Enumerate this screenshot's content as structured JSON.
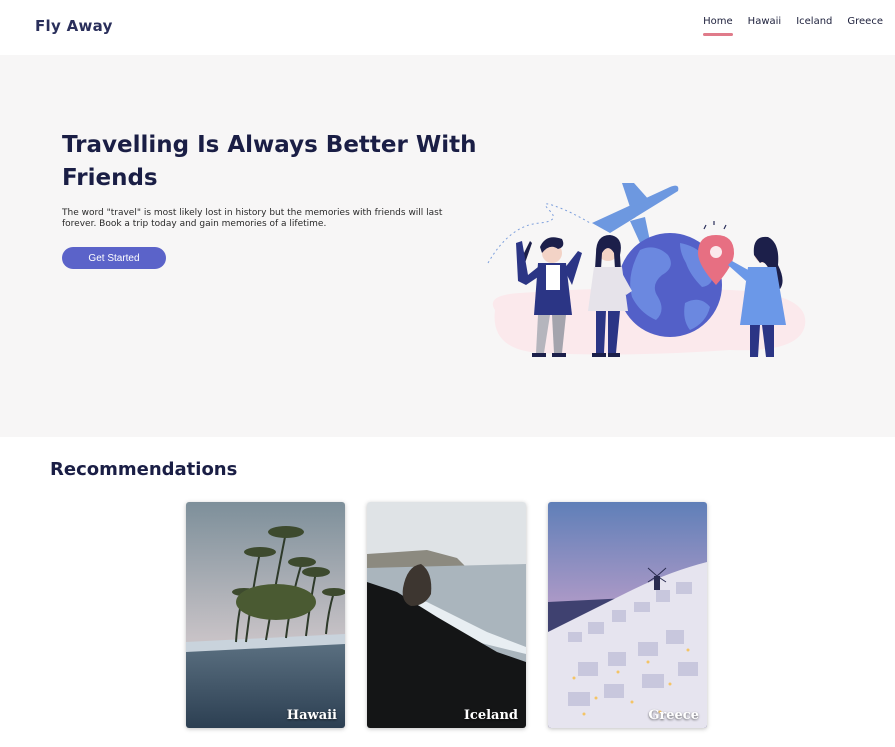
{
  "navbar": {
    "brand": "Fly Away",
    "links": [
      {
        "label": "Home",
        "active": true
      },
      {
        "label": "Hawaii",
        "active": false
      },
      {
        "label": "Iceland",
        "active": false
      },
      {
        "label": "Greece",
        "active": false
      }
    ],
    "active_underline_color": "#e07b8a"
  },
  "hero": {
    "title": "Travelling Is Always Better With Friends",
    "description": "The word \"travel\" is most likely lost in history but the memories with friends will last forever. Book a trip today and gain memories of a lifetime.",
    "cta_label": "Get Started",
    "accent_color": "#5b63c9",
    "background": "#f7f6f6",
    "illustration": "friends-travel-globe-airplane-illustration"
  },
  "recommendations": {
    "title": "Recommendations",
    "cards": [
      {
        "label": "Hawaii",
        "image": "palm-beach-photo"
      },
      {
        "label": "Iceland",
        "image": "black-sand-beach-photo"
      },
      {
        "label": "Greece",
        "image": "santorini-night-photo"
      }
    ]
  }
}
